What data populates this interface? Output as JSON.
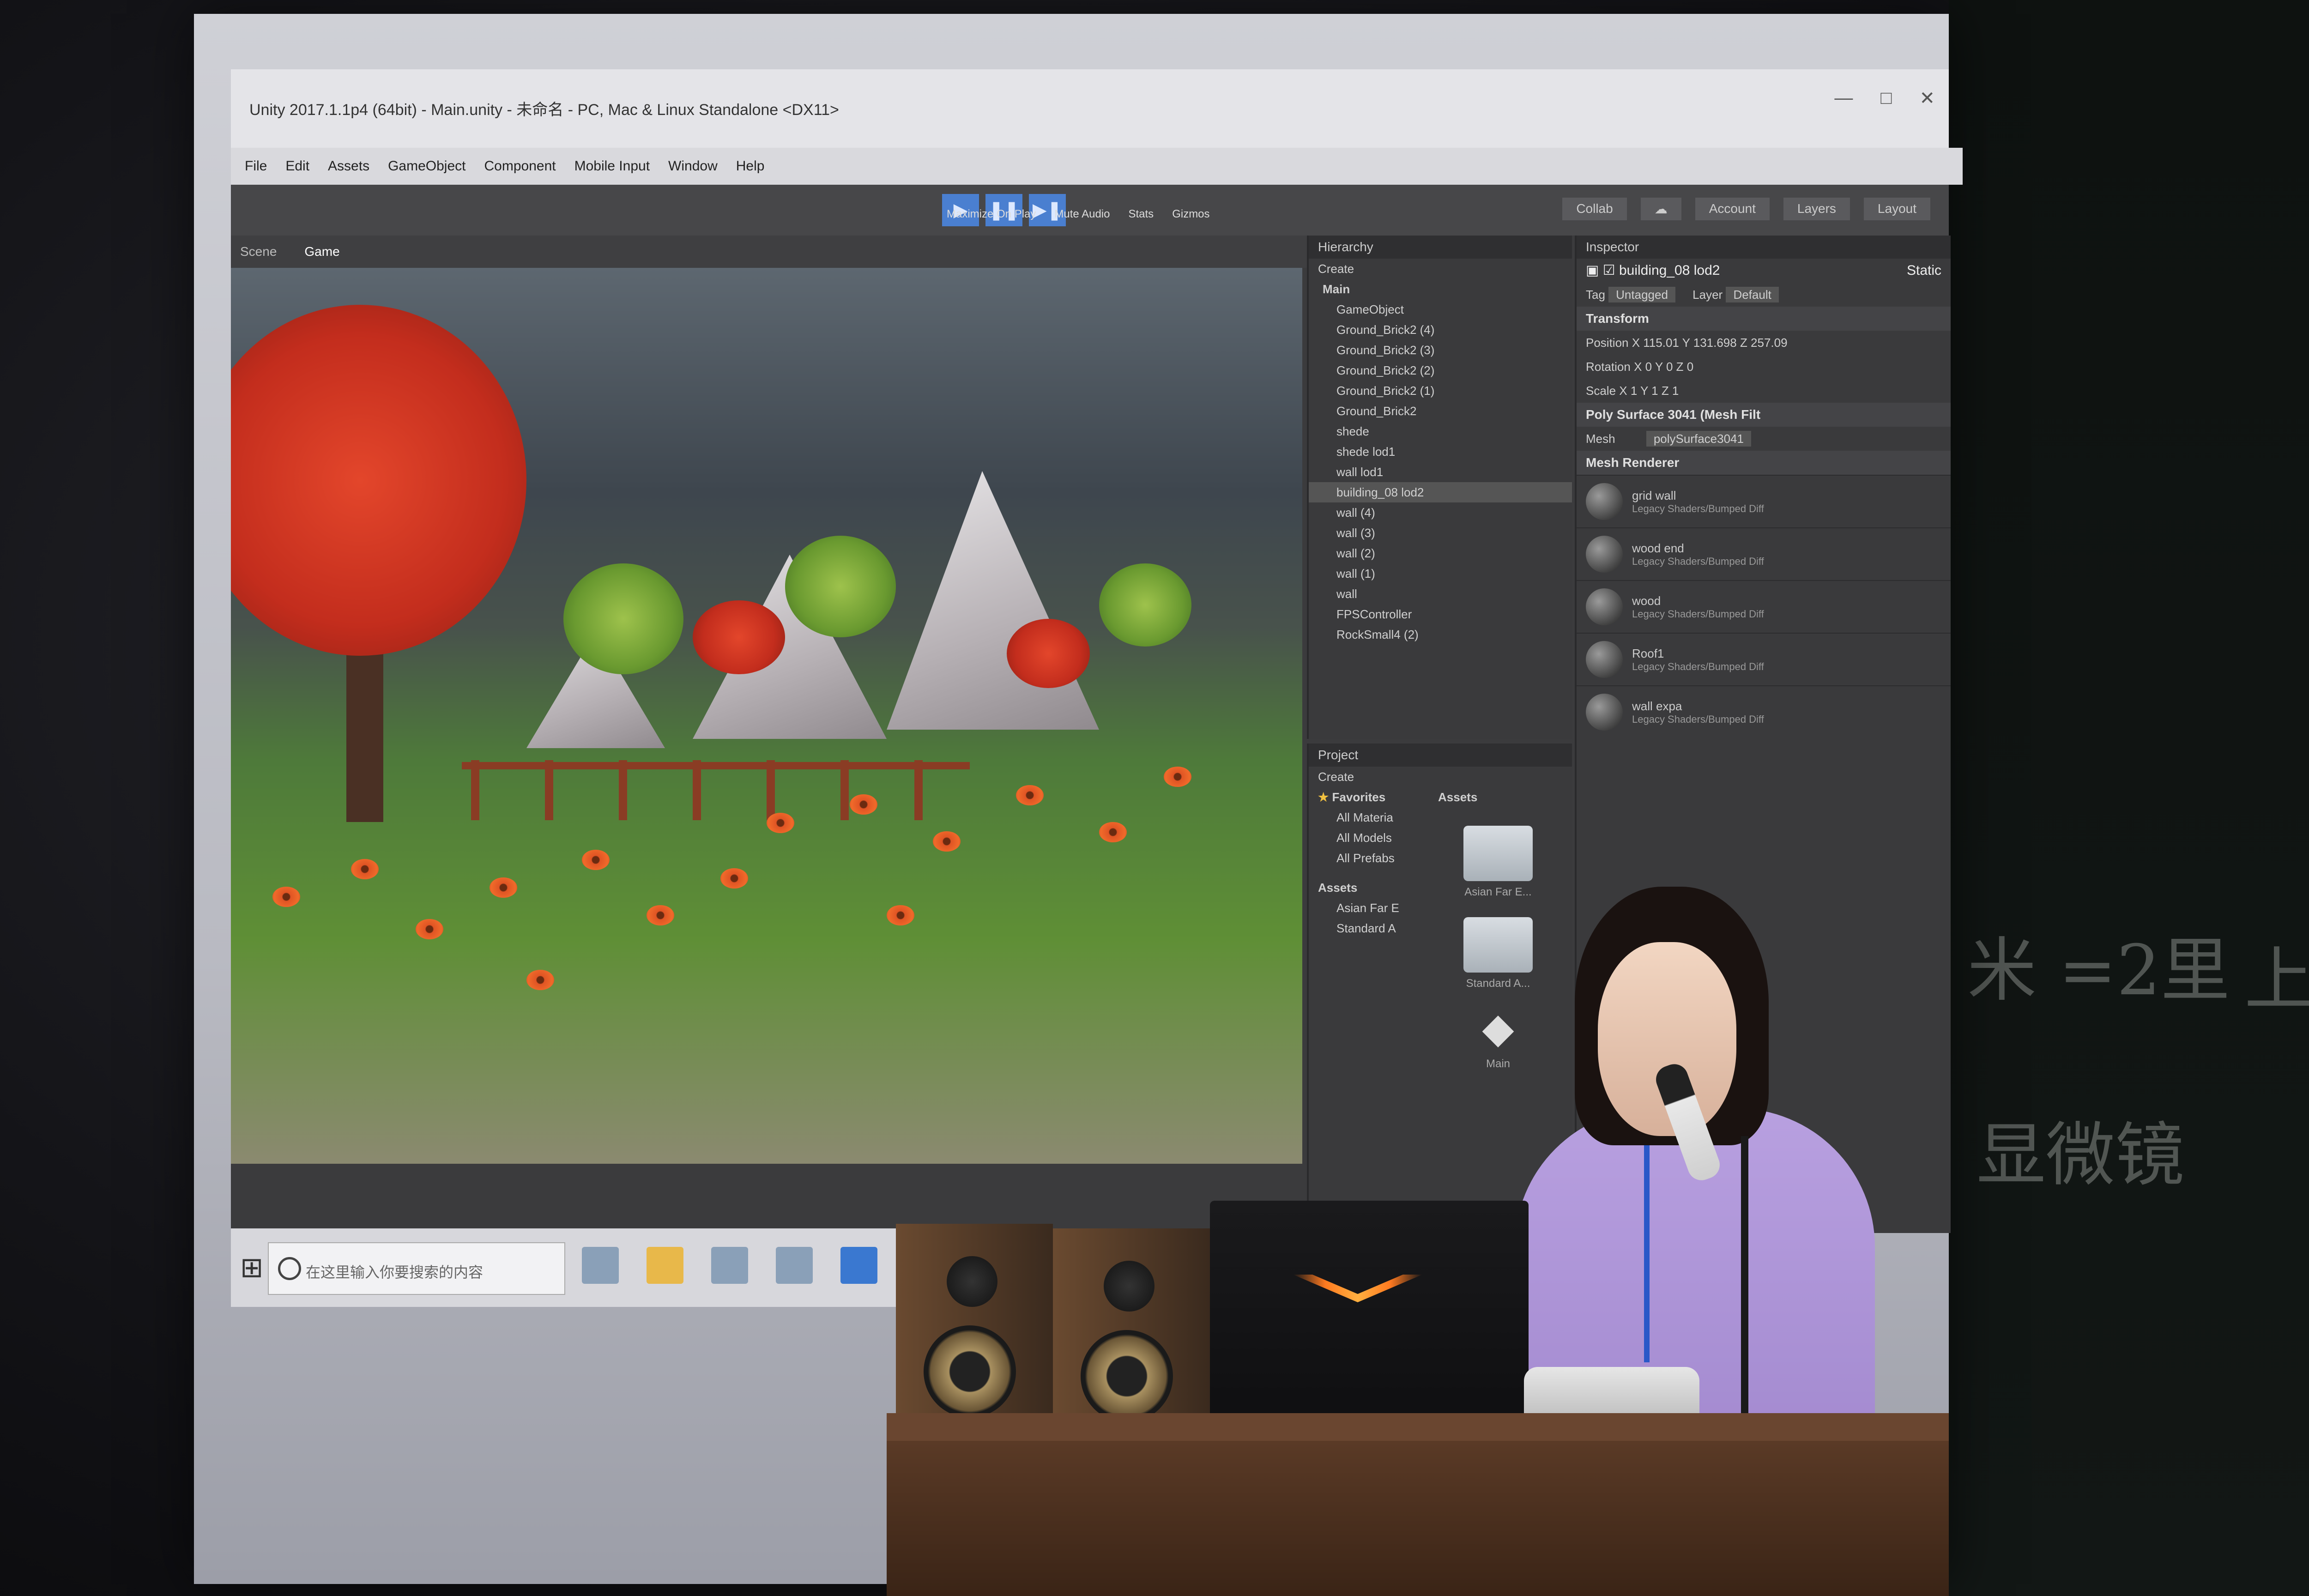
{
  "unity": {
    "title": "Unity 2017.1.1p4 (64bit) - Main.unity - 未命名 - PC, Mac & Linux Standalone <DX11>",
    "menu": [
      "File",
      "Edit",
      "Assets",
      "GameObject",
      "Component",
      "Mobile Input",
      "Window",
      "Help"
    ],
    "toolbar_right": [
      "Collab",
      "Account",
      "Layers",
      "Layout"
    ],
    "game_tabs": [
      "Scene",
      "Game"
    ],
    "game_bar": [
      "Maximize On Play",
      "Mute Audio",
      "Stats",
      "Gizmos"
    ],
    "hierarchy": {
      "title": "Hierarchy",
      "create": "Create",
      "scene": "Main",
      "items": [
        "GameObject",
        "Ground_Brick2 (4)",
        "Ground_Brick2 (3)",
        "Ground_Brick2 (2)",
        "Ground_Brick2 (1)",
        "Ground_Brick2",
        "shede",
        "shede lod1",
        "wall lod1",
        "building_08 lod2",
        "wall (4)",
        "wall (3)",
        "wall (2)",
        "wall (1)",
        "wall",
        "FPSController",
        "RockSmall4 (2)"
      ],
      "selected_index": 9
    },
    "project": {
      "title": "Project",
      "create": "Create",
      "favorites": "Favorites",
      "fav_items": [
        "All Materia",
        "All Models",
        "All Prefabs"
      ],
      "assets": "Assets",
      "asset_tree": [
        "Asian Far E",
        "Standard A"
      ],
      "assets_header": "Assets",
      "folders": [
        "Asian Far E...",
        "Standard A..."
      ],
      "scene_asset": "Main"
    },
    "inspector": {
      "title": "Inspector",
      "object_name": "building_08 lod2",
      "static": "Static",
      "tag_label": "Tag",
      "tag": "Untagged",
      "layer_label": "Layer",
      "layer": "Default",
      "transform": "Transform",
      "position": "Position   X 115.01   Y 131.698   Z 257.09",
      "rotation": "Rotation   X 0   Y 0   Z 0",
      "scale": "Scale   X 1   Y 1   Z 1",
      "mesh_filter": "Poly Surface 3041 (Mesh Filt",
      "mesh_label": "Mesh",
      "mesh_value": "polySurface3041",
      "mesh_renderer": "Mesh Renderer",
      "materials": [
        {
          "name": "grid wall",
          "shader": "Legacy Shaders/Bumped Diff"
        },
        {
          "name": "wood end",
          "shader": "Legacy Shaders/Bumped Diff"
        },
        {
          "name": "wood",
          "shader": "Legacy Shaders/Bumped Diff"
        },
        {
          "name": "Roof1",
          "shader": "Legacy Shaders/Bumped Diff"
        },
        {
          "name": "wall expa",
          "shader": "Legacy Shaders/Bumped Diff"
        }
      ]
    }
  },
  "taskbar": {
    "search_placeholder": "在这里输入你要搜索的内容"
  },
  "blackboard": [
    "米 =2里",
    "上踪",
    "显微镜"
  ],
  "colors": {
    "play_blue": "#4a7fd0",
    "shirt_lavender": "#b8a0e0",
    "laptop_glow": "#ff7a20"
  }
}
